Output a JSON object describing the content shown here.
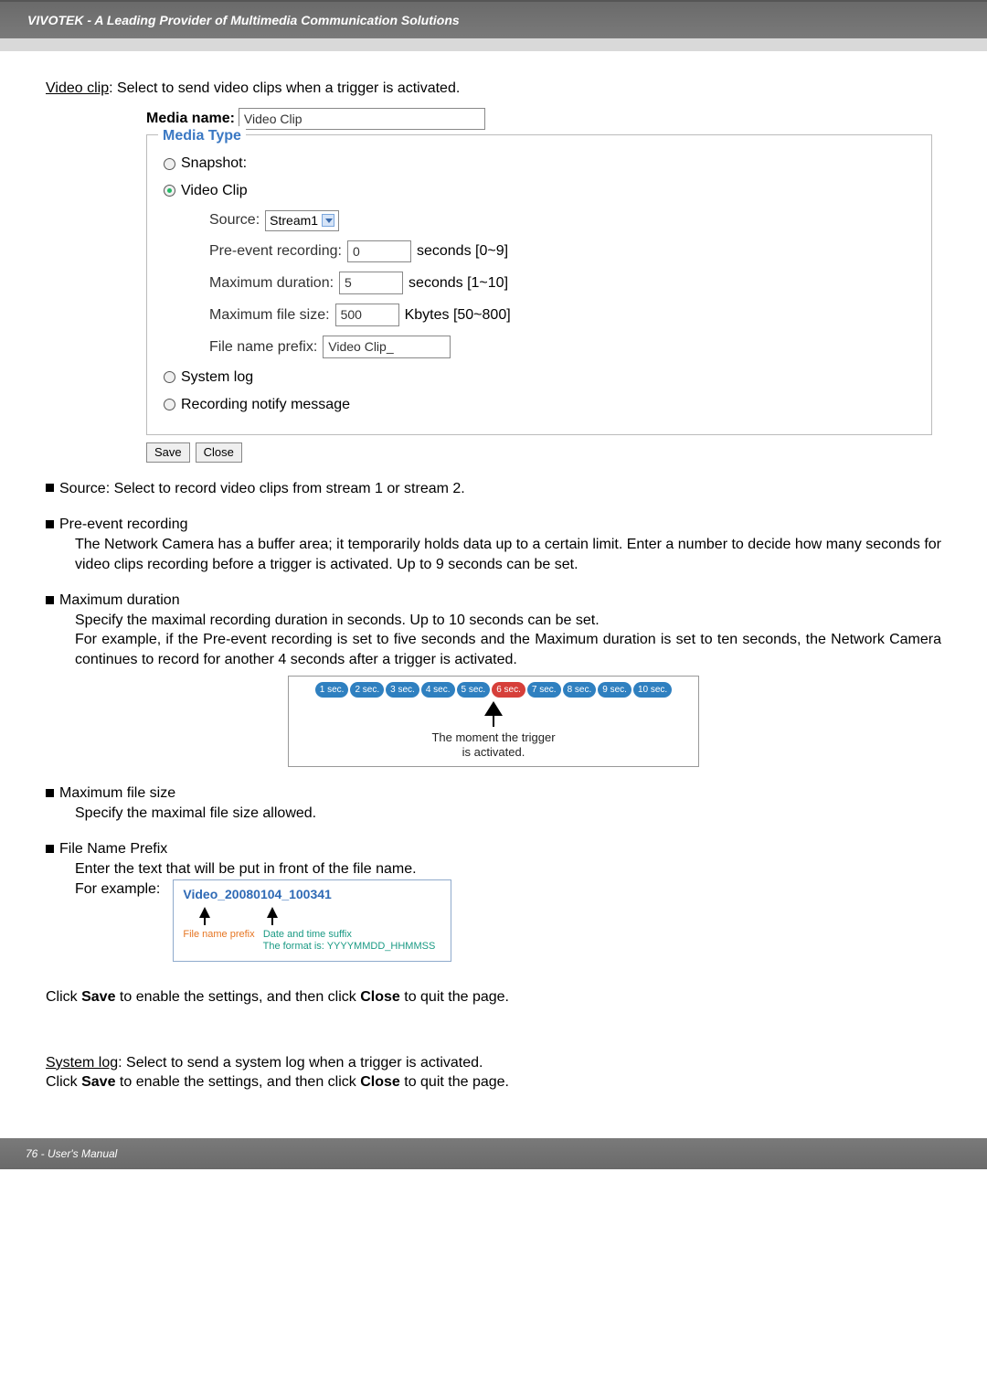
{
  "header": {
    "title": "VIVOTEK - A Leading Provider of Multimedia Communication Solutions"
  },
  "intro": {
    "video_clip_lead": "Video clip",
    "video_clip_rest": ": Select to send video clips when a trigger is activated."
  },
  "form": {
    "media_name_label": "Media name:",
    "media_name_value": "Video Clip",
    "media_type_legend": "Media Type",
    "snapshot_label": "Snapshot:",
    "video_clip_label": "Video Clip",
    "source_label": "Source:",
    "source_value": "Stream1",
    "pre_event_label": "Pre-event recording:",
    "pre_event_value": "0",
    "pre_event_suffix": "seconds [0~9]",
    "max_dur_label": "Maximum duration:",
    "max_dur_value": "5",
    "max_dur_suffix": "seconds [1~10]",
    "max_size_label": "Maximum file size:",
    "max_size_value": "500",
    "max_size_suffix": "Kbytes [50~800]",
    "file_prefix_label": "File name prefix:",
    "file_prefix_value": "Video Clip_",
    "system_log_label": "System log",
    "recording_notify_label": "Recording notify message",
    "save_label": "Save",
    "close_label": "Close"
  },
  "bullets": {
    "source_line": "Source: Select to record video clips from stream 1 or stream 2.",
    "pre_event_title": "Pre-event recording",
    "pre_event_body": "The Network Camera has a buffer area; it temporarily holds data up to a certain limit. Enter a number to decide how many seconds for video clips recording before a trigger is activated. Up to 9 seconds can be set.",
    "max_dur_title": "Maximum duration",
    "max_dur_body1": "Specify the maximal recording duration in seconds. Up to 10 seconds can be set.",
    "max_dur_body2": "For example, if the Pre-event recording is set to five seconds and the Maximum duration is set to ten seconds, the Network Camera continues to record for another 4 seconds after a trigger is activated.",
    "max_file_title": "Maximum file size",
    "max_file_body": "Specify the maximal file size allowed.",
    "file_prefix_title": "File Name Prefix",
    "file_prefix_body": "Enter the text that will be put in front of the file name.",
    "for_example": "For example:"
  },
  "timeline": {
    "labels": [
      "1 sec.",
      "2 sec.",
      "3 sec.",
      "4 sec.",
      "5 sec.",
      "6 sec.",
      "7 sec.",
      "8 sec.",
      "9 sec.",
      "10 sec."
    ],
    "highlight_index": 5,
    "caption_line1": "The moment the trigger",
    "caption_line2": "is activated."
  },
  "prefix_example": {
    "filename": "Video_20080104_100341",
    "left_label": "File name prefix",
    "right_label_1": "Date and time suffix",
    "right_label_2": "The format is: YYYYMMDD_HHMMSS"
  },
  "post_text": {
    "save_close_1a": "Click ",
    "save_close_1b": "Save",
    "save_close_1c": " to enable the settings,  and then click ",
    "save_close_1d": "Close",
    "save_close_1e": " to quit the page.",
    "system_log_lead": "System log",
    "system_log_rest": ": Select to send a system log when a trigger is activated."
  },
  "footer": {
    "page_label": "76 - User's Manual"
  }
}
